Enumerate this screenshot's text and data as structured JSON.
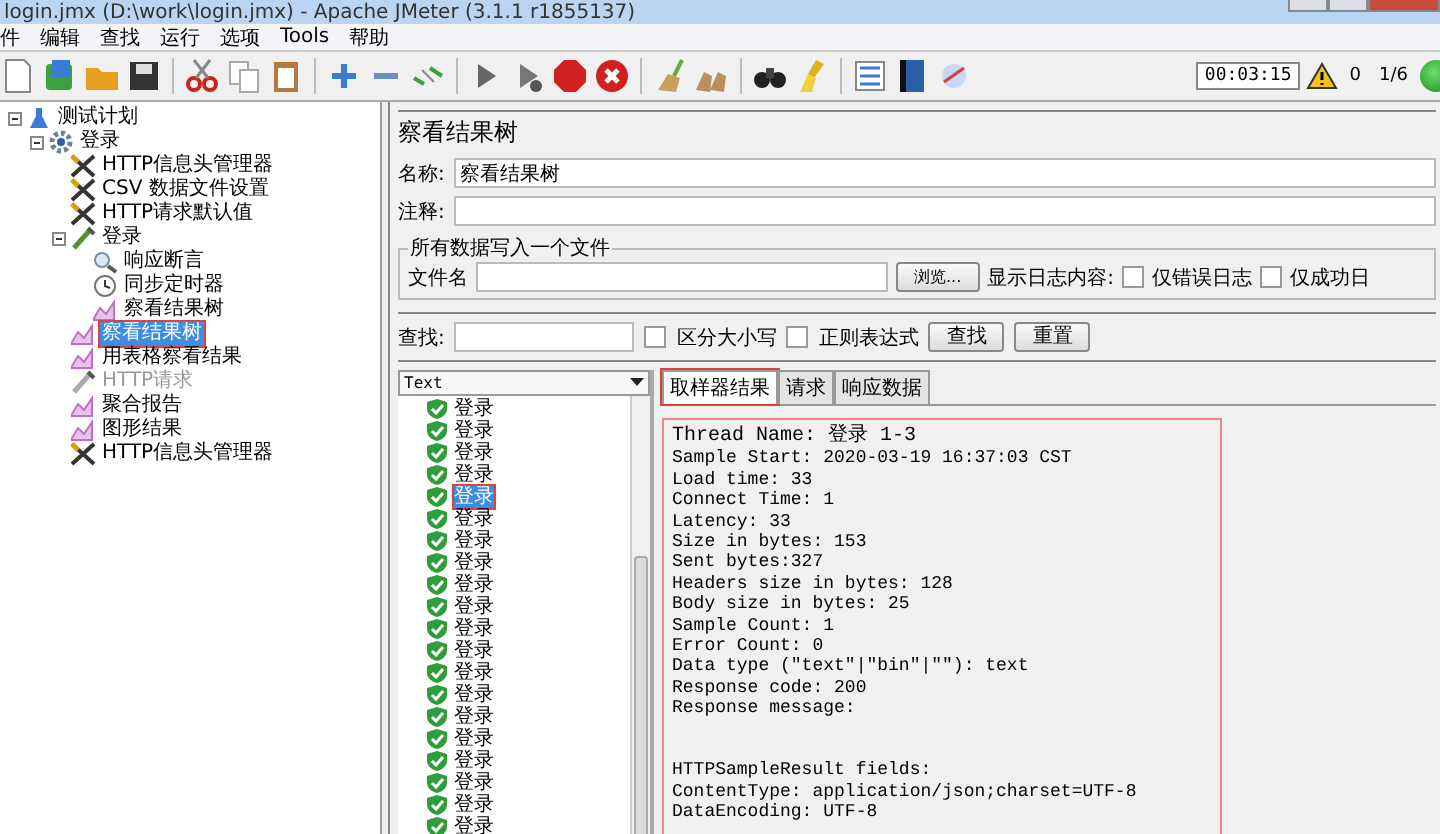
{
  "window": {
    "title": "login.jmx (D:\\work\\login.jmx) - Apache JMeter (3.1.1 r1855137)"
  },
  "menu": [
    "件",
    "编辑",
    "查找",
    "运行",
    "选项",
    "Tools",
    "帮助"
  ],
  "toolbar": {
    "timer": "00:03:15",
    "error_count": "0",
    "threads": "1/6"
  },
  "tree": [
    {
      "label": "测试计划",
      "kind": "plan",
      "expanded": true,
      "selected": false,
      "disabled": false,
      "outlined": false,
      "children": [
        {
          "label": "登录",
          "kind": "thread",
          "expanded": true,
          "selected": false,
          "disabled": false,
          "outlined": false,
          "children": [
            {
              "label": "HTTP信息头管理器",
              "kind": "config",
              "selected": false,
              "disabled": false,
              "outlined": false
            },
            {
              "label": "CSV 数据文件设置",
              "kind": "config",
              "selected": false,
              "disabled": false,
              "outlined": false
            },
            {
              "label": "HTTP请求默认值",
              "kind": "config",
              "selected": false,
              "disabled": false,
              "outlined": false
            },
            {
              "label": "登录",
              "kind": "sampler",
              "expanded": true,
              "selected": false,
              "disabled": false,
              "outlined": false,
              "children": [
                {
                  "label": "响应断言",
                  "kind": "assertion",
                  "selected": false,
                  "disabled": false,
                  "outlined": false
                },
                {
                  "label": "同步定时器",
                  "kind": "timer",
                  "selected": false,
                  "disabled": false,
                  "outlined": false
                },
                {
                  "label": "察看结果树",
                  "kind": "listener",
                  "selected": false,
                  "disabled": false,
                  "outlined": false
                }
              ]
            },
            {
              "label": "察看结果树",
              "kind": "listener",
              "selected": true,
              "disabled": false,
              "outlined": true
            },
            {
              "label": "用表格察看结果",
              "kind": "listener",
              "selected": false,
              "disabled": false,
              "outlined": false
            },
            {
              "label": "HTTP请求",
              "kind": "sampler",
              "selected": false,
              "disabled": true,
              "outlined": false
            },
            {
              "label": "聚合报告",
              "kind": "listener",
              "selected": false,
              "disabled": false,
              "outlined": false
            },
            {
              "label": "图形结果",
              "kind": "listener",
              "selected": false,
              "disabled": false,
              "outlined": false
            },
            {
              "label": "HTTP信息头管理器",
              "kind": "config",
              "selected": false,
              "disabled": false,
              "outlined": false
            }
          ]
        }
      ]
    }
  ],
  "panel": {
    "title": "察看结果树",
    "name_label": "名称:",
    "name_value": "察看结果树",
    "comment_label": "注释:",
    "file_group": {
      "legend": "所有数据写入一个文件",
      "file_label": "文件名",
      "browse": "浏览...",
      "log_label": "显示日志内容:",
      "checks": [
        {
          "label": "仅错误日志",
          "checked": false
        },
        {
          "label": "仅成功日",
          "checked": false
        }
      ]
    },
    "search": {
      "label": "查找:",
      "checks": [
        {
          "label": "区分大小写",
          "checked": false
        },
        {
          "label": "正则表达式",
          "checked": false
        }
      ],
      "buttons": [
        "查找",
        "重置"
      ]
    },
    "renderer": "Text",
    "results": [
      {
        "label": "登录",
        "selected": false,
        "outlined": false
      },
      {
        "label": "登录",
        "selected": false,
        "outlined": false
      },
      {
        "label": "登录",
        "selected": false,
        "outlined": false
      },
      {
        "label": "登录",
        "selected": false,
        "outlined": false
      },
      {
        "label": "登录",
        "selected": true,
        "outlined": true
      },
      {
        "label": "登录",
        "selected": false,
        "outlined": false
      },
      {
        "label": "登录",
        "selected": false,
        "outlined": false
      },
      {
        "label": "登录",
        "selected": false,
        "outlined": false
      },
      {
        "label": "登录",
        "selected": false,
        "outlined": false
      },
      {
        "label": "登录",
        "selected": false,
        "outlined": false
      },
      {
        "label": "登录",
        "selected": false,
        "outlined": false
      },
      {
        "label": "登录",
        "selected": false,
        "outlined": false
      },
      {
        "label": "登录",
        "selected": false,
        "outlined": false
      },
      {
        "label": "登录",
        "selected": false,
        "outlined": false
      },
      {
        "label": "登录",
        "selected": false,
        "outlined": false
      },
      {
        "label": "登录",
        "selected": false,
        "outlined": false
      },
      {
        "label": "登录",
        "selected": false,
        "outlined": false
      },
      {
        "label": "登录",
        "selected": false,
        "outlined": false
      },
      {
        "label": "登录",
        "selected": false,
        "outlined": false
      },
      {
        "label": "登录",
        "selected": false,
        "outlined": false
      }
    ],
    "tabs": [
      {
        "label": "取样器结果",
        "selected": true,
        "outlined": true
      },
      {
        "label": "请求",
        "selected": false,
        "outlined": false
      },
      {
        "label": "响应数据",
        "selected": false,
        "outlined": false
      }
    ],
    "result_outlined": true,
    "result_lines": [
      "Thread Name: 登录 1-3",
      "Sample Start: 2020-03-19 16:37:03 CST",
      "Load time: 33",
      "Connect Time: 1",
      "Latency: 33",
      "Size in bytes: 153",
      "Sent bytes:327",
      "Headers size in bytes: 128",
      "Body size in bytes: 25",
      "Sample Count: 1",
      "Error Count: 0",
      "Data type (\"text\"|\"bin\"|\"\"): text",
      "Response code: 200",
      "Response message: "
    ],
    "result_fields": [
      "HTTPSampleResult fields:",
      "ContentType: application/json;charset=UTF-8",
      "DataEncoding: UTF-8"
    ]
  }
}
